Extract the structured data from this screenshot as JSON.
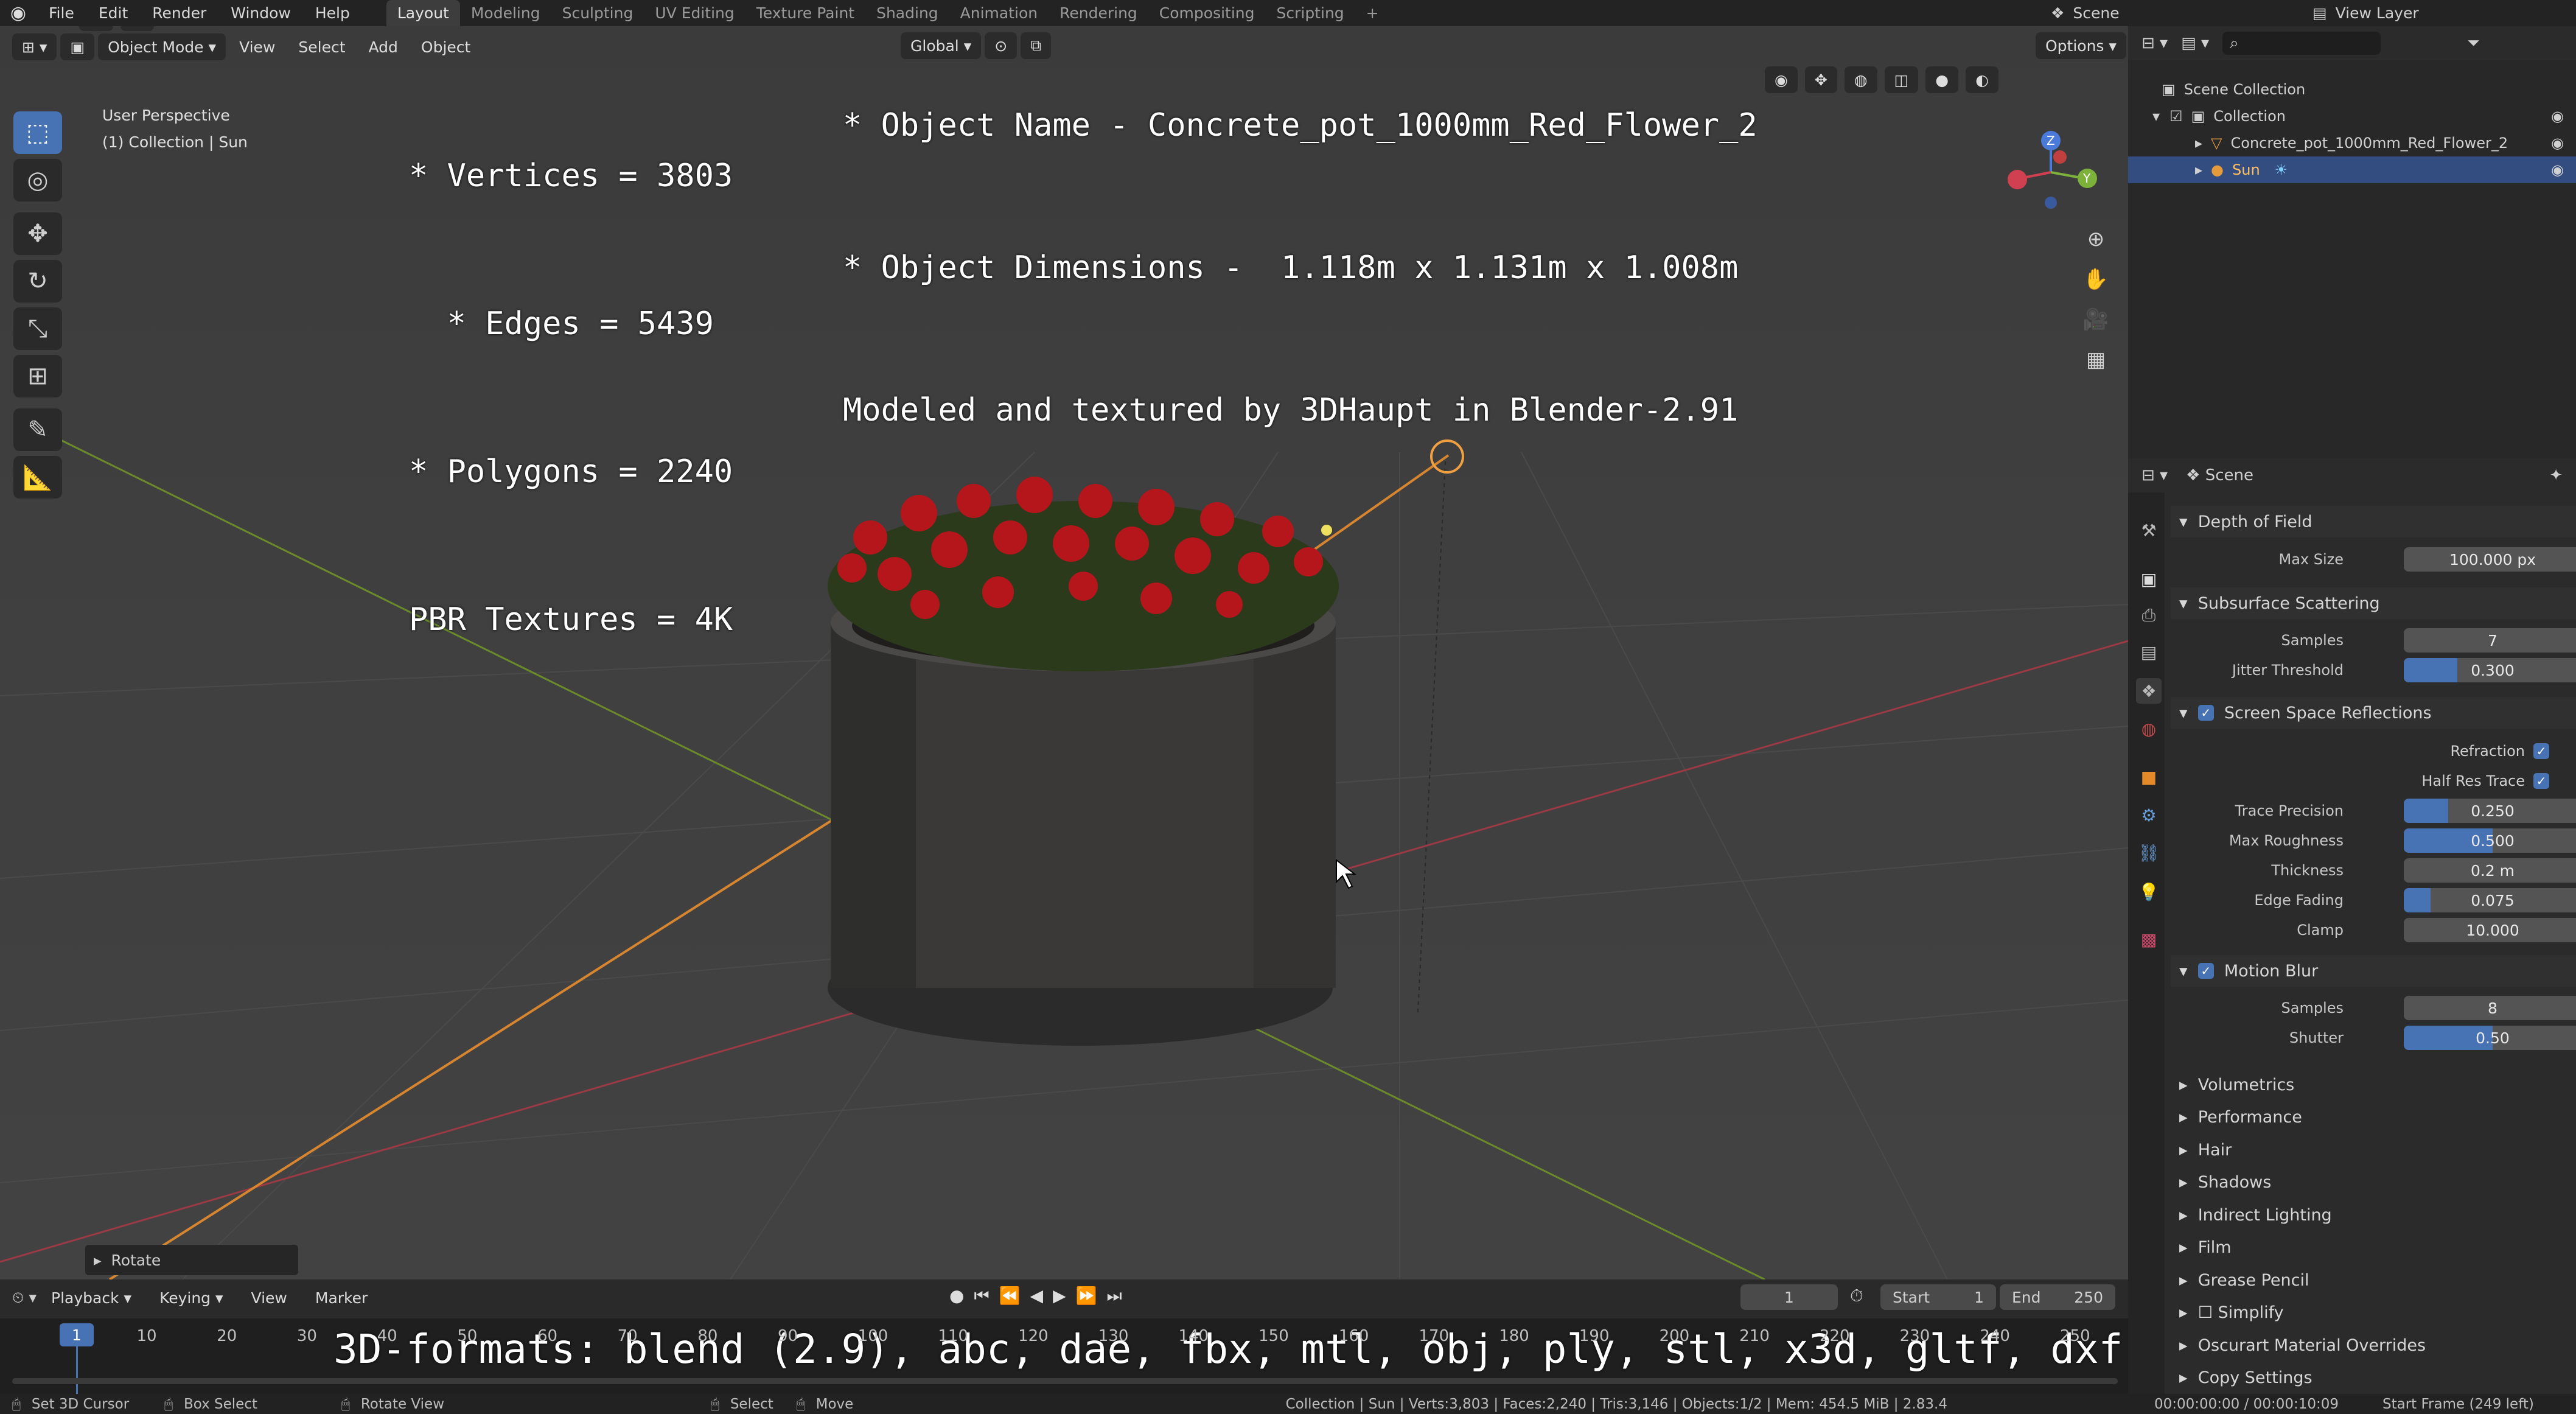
{
  "top": {
    "menus": [
      "File",
      "Edit",
      "Render",
      "Window",
      "Help"
    ],
    "workspaces": [
      "Layout",
      "Modeling",
      "Sculpting",
      "UV Editing",
      "Texture Paint",
      "Shading",
      "Animation",
      "Rendering",
      "Compositing",
      "Scripting"
    ],
    "scene": "Scene",
    "view_layer": "View Layer"
  },
  "viewport": {
    "mode": "Object Mode",
    "menus": [
      "View",
      "Select",
      "Add",
      "Object"
    ],
    "orientation": "Global",
    "options": "Options",
    "perspective": "User Perspective",
    "collection_info": "(1) Collection | Sun",
    "last_op": "Rotate"
  },
  "overlay": {
    "left": [
      "* Vertices = 3803",
      "  * Edges = 5439",
      "* Polygons = 2240",
      "PBR Textures = 4K"
    ],
    "right": [
      "* Object Name - Concrete_pot_1000mm_Red_Flower_2",
      "* Object Dimensions -  1.118m x 1.131m x 1.008m",
      "Modeled and textured by 3DHaupt in Blender-2.91"
    ],
    "bottom": "3D-formats: blend (2.9), abc, dae, fbx, mtl, obj, ply, stl, x3d, gltf, dxf"
  },
  "outliner": {
    "scene_collection": "Scene Collection",
    "collection": "Collection",
    "items": [
      "Concrete_pot_1000mm_Red_Flower_2",
      "Sun"
    ]
  },
  "properties": {
    "context": "Scene",
    "dof": {
      "title": "Depth of Field",
      "max_size_label": "Max Size",
      "max_size": "100.000 px"
    },
    "sss": {
      "title": "Subsurface Scattering",
      "samples_label": "Samples",
      "samples": "7",
      "jitter_label": "Jitter Threshold",
      "jitter": "0.300",
      "jitter_frac": 0.3
    },
    "ssr": {
      "title": "Screen Space Reflections",
      "refraction": "Refraction",
      "half_res": "Half Res Trace",
      "rows": [
        {
          "label": "Trace Precision",
          "value": "0.250",
          "frac": 0.25
        },
        {
          "label": "Max Roughness",
          "value": "0.500",
          "frac": 0.5
        },
        {
          "label": "Thickness",
          "value": "0.2 m",
          "frac": 0
        },
        {
          "label": "Edge Fading",
          "value": "0.075",
          "frac": 0.15
        },
        {
          "label": "Clamp",
          "value": "10.000",
          "frac": 0
        }
      ]
    },
    "mb": {
      "title": "Motion Blur",
      "samples_label": "Samples",
      "samples": "8",
      "shutter_label": "Shutter",
      "shutter": "0.50",
      "shutter_frac": 0.5
    },
    "collapsed": [
      "Volumetrics",
      "Performance",
      "Hair",
      "Shadows",
      "Indirect Lighting",
      "Film",
      "Grease Pencil",
      "Simplify",
      "Oscurart Material Overrides",
      "Copy Settings"
    ]
  },
  "timeline": {
    "menus": [
      "Playback",
      "Keying",
      "View",
      "Marker"
    ],
    "current": "1",
    "start_label": "Start",
    "start": "1",
    "end_label": "End",
    "end": "250",
    "ticks": [
      "1",
      "10",
      "20",
      "30",
      "40",
      "50",
      "60",
      "70",
      "80",
      "90",
      "100",
      "110",
      "120",
      "130",
      "140",
      "150",
      "160",
      "170",
      "180",
      "190",
      "200",
      "210",
      "220",
      "230",
      "240",
      "250"
    ]
  },
  "status": {
    "left": [
      "Set 3D Cursor",
      "Box Select",
      "Rotate View",
      "Select",
      "Move"
    ],
    "info": "Collection | Sun | Verts:3,803 | Faces:2,240 | Tris:3,146 | Objects:1/2 | Mem: 454.5 MiB | 2.83.4",
    "time": "00:00:00:00 / 00:00:10:09",
    "frame": "Start Frame (249 left)"
  }
}
